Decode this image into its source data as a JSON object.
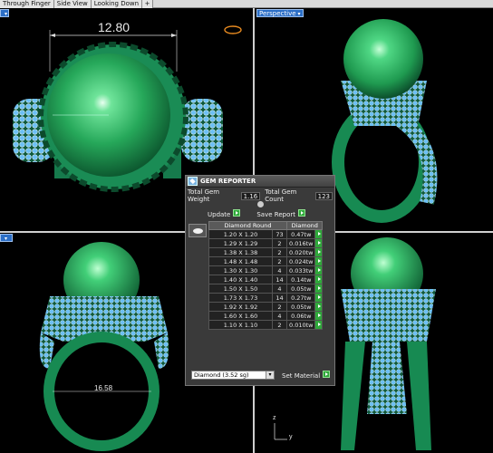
{
  "tabs": [
    "Through Finger",
    "Side View",
    "Looking Down",
    "+"
  ],
  "viewports": {
    "top_right_label": "Perspective",
    "top_left_dimension": "12.80",
    "bottom_left_dimension": "16.58",
    "axis_z": "z",
    "axis_y": "y"
  },
  "gem_reporter": {
    "title": "GEM REPORTER",
    "total_weight_label": "Total Gem Weight",
    "total_weight_value": "1.16",
    "total_count_label": "Total Gem Count",
    "total_count_value": "123",
    "update_label": "Update",
    "save_report_label": "Save Report",
    "columns": [
      "Diamond Round",
      "Diamond"
    ],
    "rows": [
      {
        "size": "1.20 X 1.20",
        "count": "73",
        "weight": "0.47tw"
      },
      {
        "size": "1.29 X 1.29",
        "count": "2",
        "weight": "0.016tw"
      },
      {
        "size": "1.38 X 1.38",
        "count": "2",
        "weight": "0.020tw"
      },
      {
        "size": "1.48 X 1.48",
        "count": "2",
        "weight": "0.024tw"
      },
      {
        "size": "1.30 X 1.30",
        "count": "4",
        "weight": "0.033tw"
      },
      {
        "size": "1.40 X 1.40",
        "count": "14",
        "weight": "0.14tw"
      },
      {
        "size": "1.50 X 1.50",
        "count": "4",
        "weight": "0.05tw"
      },
      {
        "size": "1.73 X 1.73",
        "count": "14",
        "weight": "0.27tw"
      },
      {
        "size": "1.92 X 1.92",
        "count": "2",
        "weight": "0.05tw"
      },
      {
        "size": "1.60 X 1.60",
        "count": "4",
        "weight": "0.06tw"
      },
      {
        "size": "1.10 X 1.10",
        "count": "2",
        "weight": "0.010tw"
      }
    ],
    "material_value": "Diamond   (3.52 sg)",
    "set_material_label": "Set Material"
  },
  "colors": {
    "metal": "#1d8f5a",
    "pearl": "#2fbf63",
    "diamond": "#5aaef0",
    "label_bg": "#2c6fc7"
  }
}
